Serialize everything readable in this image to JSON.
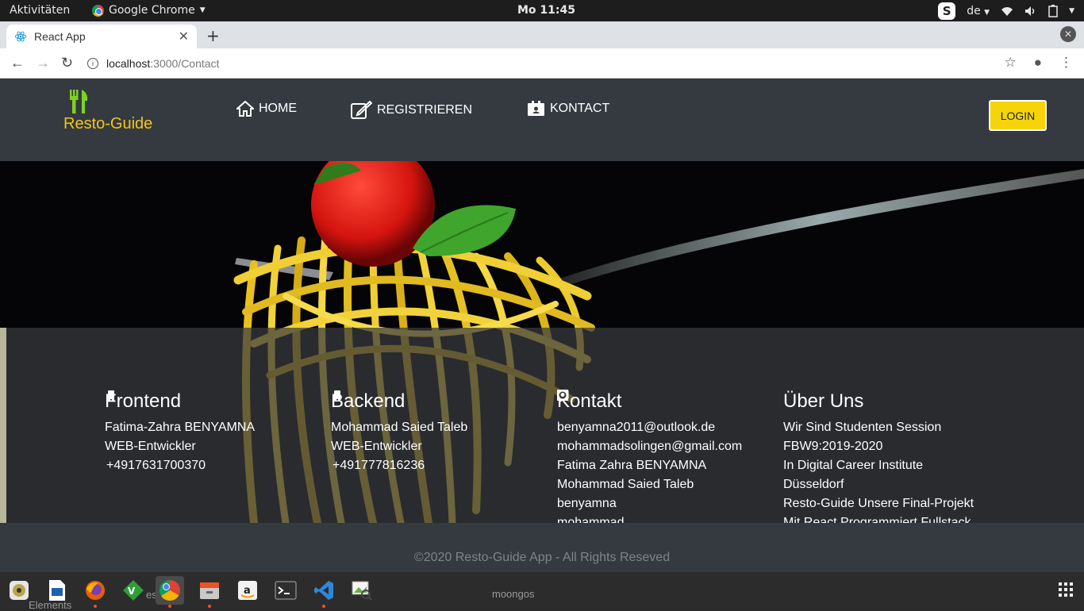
{
  "system_bar": {
    "activities": "Aktivitäten",
    "app_name": "Google Chrome",
    "clock": "Mo 11:45",
    "keyboard_layout": "de"
  },
  "browser": {
    "tab_title": "React App",
    "url_host": "localhost",
    "url_path": ":3000/Contact"
  },
  "app": {
    "brand": "Resto-Guide",
    "nav": [
      {
        "label": "HOME",
        "icon": "home-icon"
      },
      {
        "label": "REGISTRIEREN",
        "icon": "edit-icon"
      },
      {
        "label": "KONTACT",
        "icon": "contact-card-icon"
      }
    ],
    "login_label": "LOGIN",
    "colors": {
      "brand_yellow": "#f5c518",
      "icon_green": "#7ed321",
      "header_bg": "#343a40",
      "login_bg": "#f5d50a"
    }
  },
  "contact": {
    "frontend": {
      "title": "Frontend",
      "name": "Fatima-Zahra BENYAMNA",
      "role": "WEB-Entwickler",
      "phone": "+4917631700370"
    },
    "backend": {
      "title": "Backend",
      "name": "Mohammad Saied Taleb",
      "role": "WEB-Entwickler",
      "phone": "+491777816236"
    },
    "kontakt": {
      "title": "Kontakt",
      "email1": "benyamna2011@outlook.de",
      "email2": "mohammadsolingen@gmail.com",
      "linkedin1": "Fatima Zahra BENYAMNA",
      "linkedin2": "Mohammad Saied Taleb",
      "github1": "benyamna",
      "github2": "mohammad"
    },
    "about": {
      "title": "Über Uns",
      "lines": [
        "Wir Sind Studenten Session",
        "FBW9:2019-2020",
        "In Digital Career Institute",
        "Düsseldorf",
        "Resto-Guide Unsere Final-Projekt",
        "Mit React Programmiert Fullstack"
      ]
    }
  },
  "footer": {
    "copyright": "©2020 Resto-Guide App - All Rights Reseved"
  },
  "dock": {
    "ghost_label_1": "Elements",
    "ghost_label_2": "moongos",
    "ghost_label_3": "eso"
  }
}
